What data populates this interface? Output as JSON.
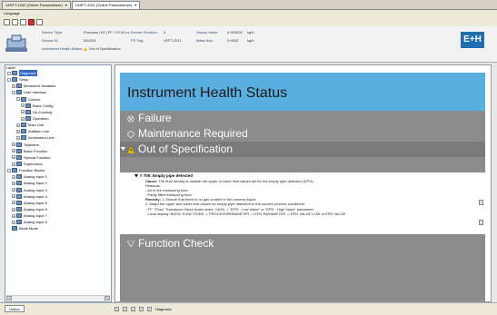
{
  "tabs": [
    {
      "label": "1ASFT-1000 (Online Parameterize)",
      "active": false
    },
    {
      "label": "1ASFT-2011 (Online Parameterize)",
      "active": true
    }
  ],
  "menu": {
    "language": "Language"
  },
  "device_header": {
    "rows": [
      {
        "label": "Device Type:",
        "value": "Promass | 83 | FF / V2.00.xx",
        "label2": "Device Revision:",
        "value2": "3",
        "label3": "Output Value:",
        "value3": "0.000000",
        "unit": "kg/h"
      },
      {
        "label": "Device ID:",
        "value": "3A1951",
        "label2": "PD Tag:",
        "value2": "1SFT-2011",
        "label3": "Mass flow:",
        "value3": "0.0000",
        "unit": "kg/h"
      },
      {
        "label": "Instrument Health Status:",
        "value": "Out of Specification",
        "label2": "",
        "value2": "",
        "label3": "",
        "value3": "",
        "unit": ""
      }
    ],
    "logo": "E+H"
  },
  "tree": {
    "title": "Label",
    "items": [
      {
        "label": "Diagnosis",
        "indent": 1,
        "sel": true,
        "pm": "-"
      },
      {
        "label": "Setup",
        "indent": 1,
        "pm": "-"
      },
      {
        "label": "Measured Variables",
        "indent": 2,
        "pm": "+"
      },
      {
        "label": "User Interface",
        "indent": 2,
        "pm": "-"
      },
      {
        "label": "Control",
        "indent": 3,
        "pm": "-"
      },
      {
        "label": "Basic Config",
        "indent": 4,
        "pm": "+"
      },
      {
        "label": "Un-/Locking",
        "indent": 4,
        "pm": "+"
      },
      {
        "label": "Operation",
        "indent": 4,
        "pm": "+"
      },
      {
        "label": "Main Line",
        "indent": 3,
        "pm": "+"
      },
      {
        "label": "Addition Line",
        "indent": 3,
        "pm": "+"
      },
      {
        "label": "Information Line",
        "indent": 3,
        "pm": "+"
      },
      {
        "label": "Totalizers",
        "indent": 2,
        "pm": "+"
      },
      {
        "label": "Basic Function",
        "indent": 2,
        "pm": "+"
      },
      {
        "label": "Special Function",
        "indent": 2,
        "pm": "+"
      },
      {
        "label": "Supervision",
        "indent": 2,
        "pm": "+"
      },
      {
        "label": "Function Blocks",
        "indent": 1,
        "pm": "-"
      },
      {
        "label": "Analog Input 1",
        "indent": 2,
        "pm": "+"
      },
      {
        "label": "Analog Input 2",
        "indent": 2,
        "pm": "+"
      },
      {
        "label": "Analog Input 3",
        "indent": 2,
        "pm": "+"
      },
      {
        "label": "Analog Input 4",
        "indent": 2,
        "pm": "+"
      },
      {
        "label": "Analog Input 5",
        "indent": 2,
        "pm": "+"
      },
      {
        "label": "Analog Input 6",
        "indent": 2,
        "pm": "+"
      },
      {
        "label": "Analog Input 7",
        "indent": 2,
        "pm": "+"
      },
      {
        "label": "Analog Input 8",
        "indent": 2,
        "pm": "+"
      },
      {
        "label": "Block Mode",
        "indent": 1,
        "pm": ""
      }
    ]
  },
  "main": {
    "title": "Instrument Health Status",
    "categories": [
      "Failure",
      "Maintenance Required",
      "Out of Specification"
    ],
    "detail": {
      "heading": "# 700: Empty pipe detected",
      "cause_label": "Cause:",
      "cause": "The fluid density is outside the upper or lower limit values set for the empty pipe detection (EPD).",
      "reasons_label": "Reasons:",
      "reasons": [
        "- Air in the measuring tube.",
        "- Partly filled measuring tube."
      ],
      "remedy_label": "Remedy:",
      "remedy": [
        "1. Ensure that there is no gas content in the process liquid.",
        "2. Adapt the upper and lower limit values for empty pipe detection to the current process conditions:",
        "- FF: \"Flow\" Transducer Block (base index: 1400) -> \"EPD - Low Value\" or \"EPD - High Value\" parameter",
        "- Local display: BASIC FUNCTIONS -> PROCESSPARAMETER -> EPD PARAMETER -> EPD VALUE LOW or EPD VALUE"
      ]
    },
    "function_check": "Function Check"
  },
  "bottom": {
    "online": "Online",
    "diagnosis": "Diagnosis"
  },
  "colors": {
    "header_blue": "#5aaee0",
    "status_gray": "#8c8c8c",
    "selection": "#316ac5"
  }
}
